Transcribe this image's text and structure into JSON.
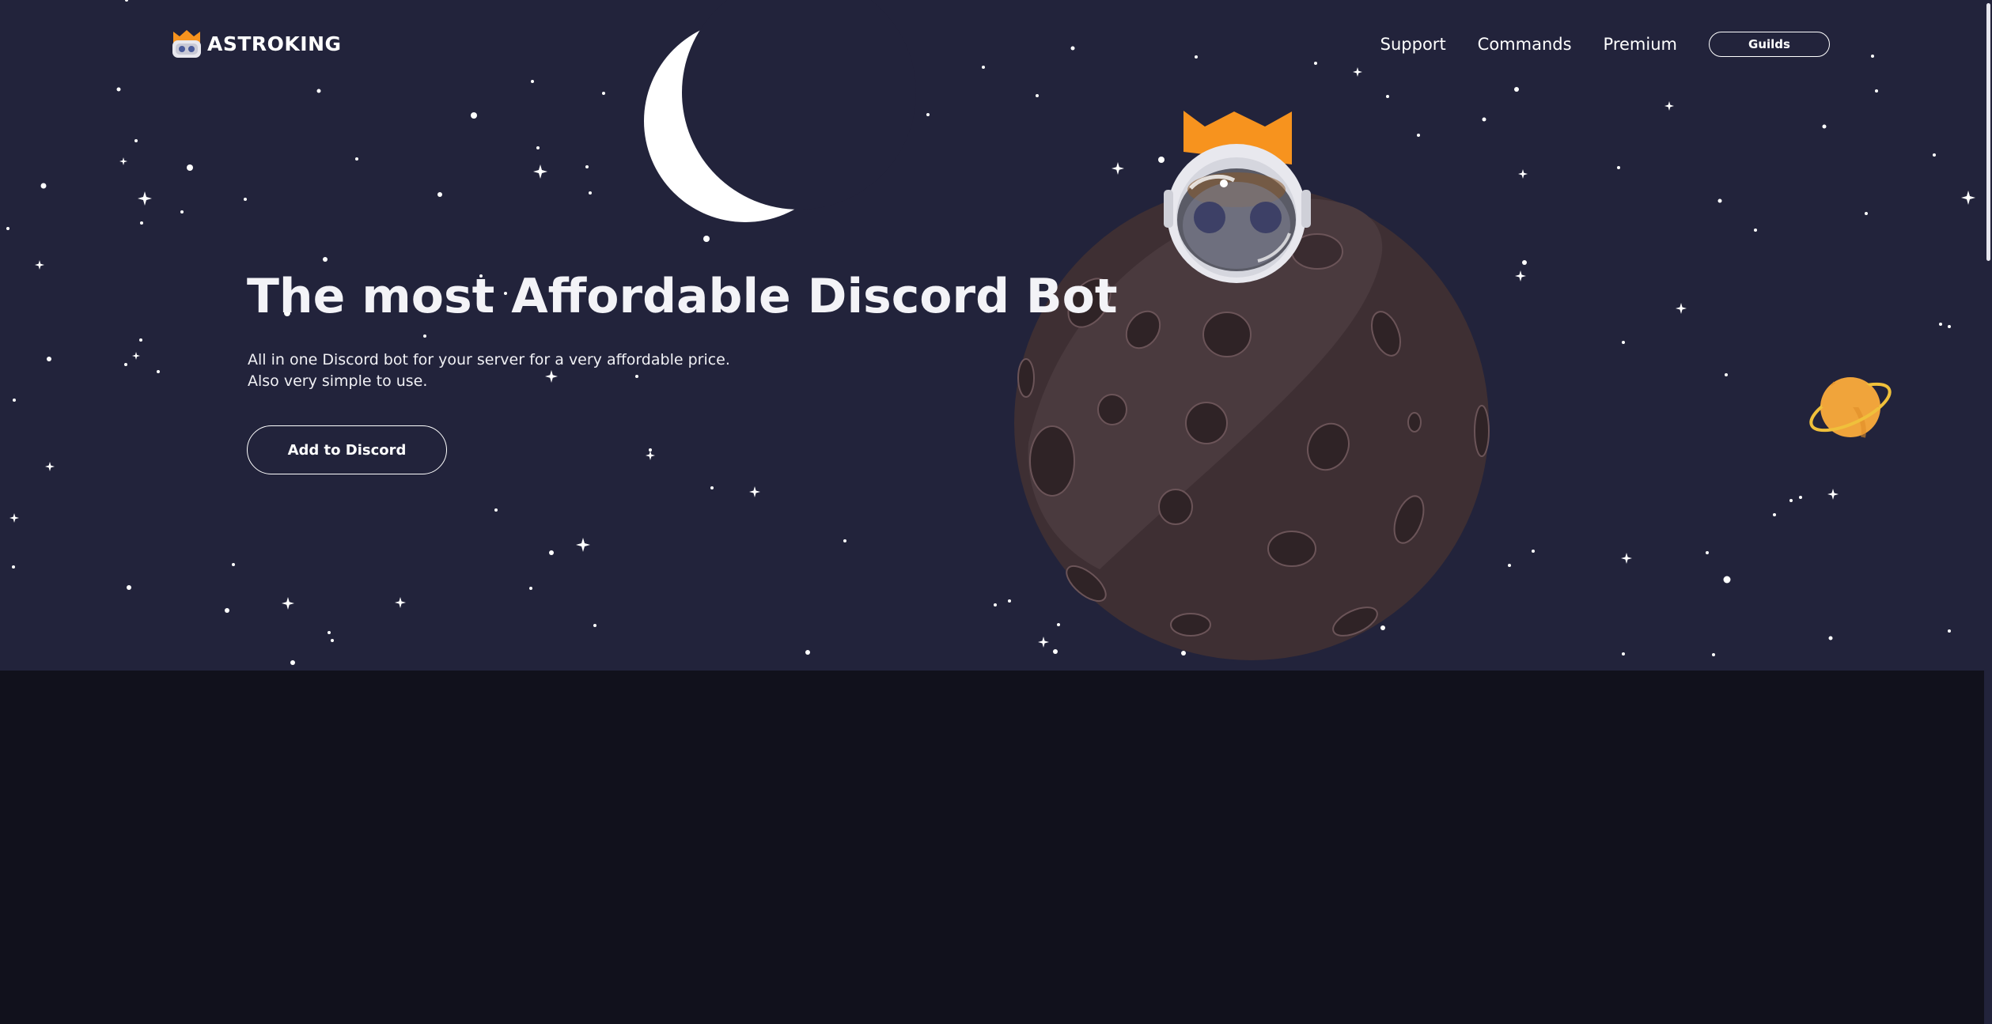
{
  "brand": {
    "name": "ASTROKING",
    "logo_icon": "crowned-bot-icon",
    "accent": "#f7931e"
  },
  "nav": {
    "links": [
      "Support",
      "Commands",
      "Premium"
    ],
    "button_label": "Guilds"
  },
  "hero": {
    "headline": "The most Affordable Discord Bot",
    "sub_line_1": "All in one Discord bot for your server for a very affordable price.",
    "sub_line_2": "Also very simple to use.",
    "cta_label": "Add to Discord",
    "illustration": [
      "moon-illustration",
      "planet-illustration",
      "astronaut-bot-illustration",
      "ringed-planet-illustration",
      "stars-background"
    ]
  },
  "colors": {
    "hero_bg": "#22233b",
    "page_bg": "#11111c",
    "planet": "#4a3a3e",
    "crown": "#f7931e"
  }
}
